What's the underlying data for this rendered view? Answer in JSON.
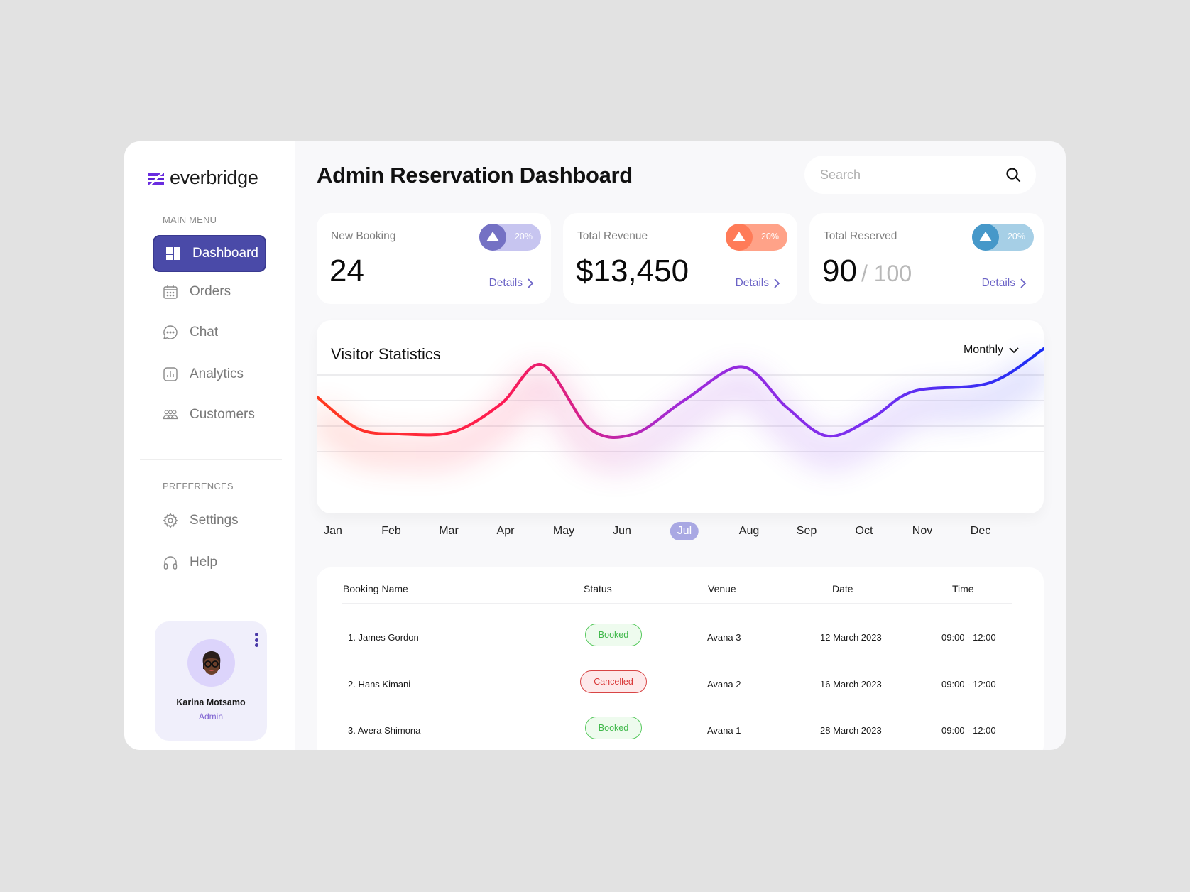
{
  "brand": {
    "name": "everbridge",
    "color": "#6a2ce0"
  },
  "sidebar": {
    "main_menu_label": "MAIN MENU",
    "main_items": [
      {
        "label": "Dashboard",
        "icon": "dashboard-icon",
        "active": true
      },
      {
        "label": "Orders",
        "icon": "calendar-icon"
      },
      {
        "label": "Chat",
        "icon": "chat-icon"
      },
      {
        "label": "Analytics",
        "icon": "analytics-icon"
      },
      {
        "label": "Customers",
        "icon": "customers-icon"
      }
    ],
    "preferences_label": "PREFERENCES",
    "pref_items": [
      {
        "label": "Settings",
        "icon": "gear-icon"
      },
      {
        "label": "Help",
        "icon": "headphones-icon"
      }
    ],
    "profile": {
      "name": "Karina Motsamo",
      "role": "Admin"
    }
  },
  "header": {
    "title": "Admin Reservation Dashboard",
    "search": {
      "placeholder": "Search",
      "value": ""
    }
  },
  "stats": [
    {
      "label": "New Booking",
      "value": "24",
      "sub": "",
      "change": "20%",
      "trend": "up",
      "details": "Details",
      "color": "#7471c4",
      "color_light": "#c7c5f0"
    },
    {
      "label": "Total Revenue",
      "value": "$13,450",
      "sub": "",
      "change": "20%",
      "trend": "up",
      "details": "Details",
      "color": "#ff7b58",
      "color_light": "#ffa288"
    },
    {
      "label": "Total Reserved",
      "value": "90",
      "sub": "/ 100",
      "change": "20%",
      "trend": "up",
      "details": "Details",
      "color": "#4698c9",
      "color_light": "#a6cfe6"
    }
  ],
  "visitor_chart": {
    "title": "Visitor Statistics",
    "period": "Monthly",
    "selected_month": "Jul"
  },
  "chart_data": {
    "type": "line",
    "title": "Visitor Statistics",
    "xlabel": "",
    "ylabel": "",
    "categories": [
      "Jan",
      "Feb",
      "Mar",
      "Apr",
      "May",
      "Jun",
      "Jul",
      "Aug",
      "Sep",
      "Oct",
      "Nov",
      "Dec"
    ],
    "x": [
      0,
      0.65,
      1.3,
      2.15,
      2.9,
      3.55,
      4.3,
      5.0,
      5.8,
      6.7,
      7.4,
      8.05,
      8.75,
      9.4,
      10.6,
      11.45
    ],
    "y": [
      55,
      25,
      20,
      22,
      48,
      85,
      25,
      20,
      52,
      83,
      45,
      18,
      35,
      60,
      68,
      100
    ],
    "ylim": [
      0,
      100
    ],
    "grid": true,
    "legend": "none",
    "gradient_colors": [
      "#ff3a1e",
      "#ff1a50",
      "#a02ad8",
      "#7a2ef0",
      "#1a2ef5"
    ]
  },
  "table": {
    "columns": [
      "Booking Name",
      "Status",
      "Venue",
      "Date",
      "Time"
    ],
    "rows": [
      {
        "name": "1. James Gordon",
        "status": "Booked",
        "status_type": "booked",
        "venue": "Avana 3",
        "date": "12 March 2023",
        "time": "09:00 - 12:00"
      },
      {
        "name": "2. Hans Kimani",
        "status": "Cancelled",
        "status_type": "cancelled",
        "venue": "Avana 2",
        "date": "16 March 2023",
        "time": "09:00 - 12:00"
      },
      {
        "name": "3. Avera Shimona",
        "status": "Booked",
        "status_type": "booked",
        "venue": "Avana 1",
        "date": "28 March 2023",
        "time": "09:00 - 12:00"
      }
    ]
  }
}
